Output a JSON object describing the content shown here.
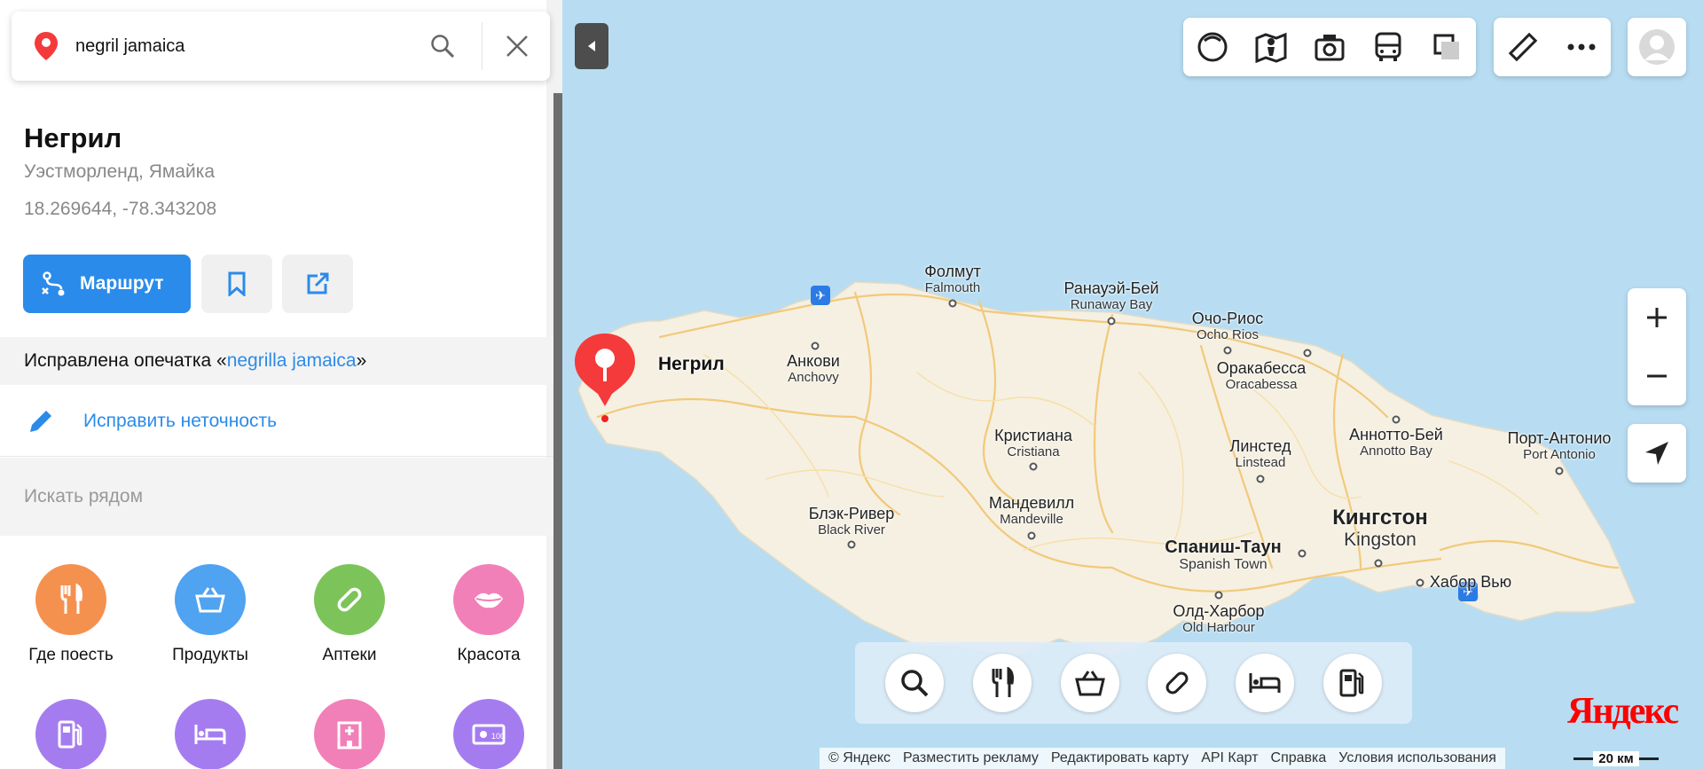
{
  "search": {
    "query": "negril jamaica"
  },
  "place": {
    "title": "Негрил",
    "subtitle": "Уэстморленд, Ямайка",
    "coords": "18.269644, -78.343208"
  },
  "actions": {
    "route_label": "Маршрут"
  },
  "typo": {
    "prefix": "Исправлена опечатка «",
    "link": "negrilla jamaica",
    "suffix": "»"
  },
  "fix_label": "Исправить неточность",
  "nearby_label": "Искать рядом",
  "categories": [
    {
      "label": "Где поесть",
      "color": "#f5914f",
      "icon": "fork-knife-icon"
    },
    {
      "label": "Продукты",
      "color": "#4fa3f0",
      "icon": "basket-icon"
    },
    {
      "label": "Аптеки",
      "color": "#7cc45a",
      "icon": "pill-icon"
    },
    {
      "label": "Красота",
      "color": "#f280b8",
      "icon": "lips-icon"
    },
    {
      "label": "",
      "color": "#a57cf0",
      "icon": "gas-station-icon"
    },
    {
      "label": "",
      "color": "#a57cf0",
      "icon": "bed-icon"
    },
    {
      "label": "",
      "color": "#f280b8",
      "icon": "hospital-icon"
    },
    {
      "label": "",
      "color": "#a57cf0",
      "icon": "money-icon"
    }
  ],
  "map": {
    "negril_label": "Негрил",
    "places": [
      {
        "ru": "Фолмут",
        "en": "Falmouth",
        "cls": "town"
      },
      {
        "ru": "Ранауэй-Бей",
        "en": "Runaway Bay",
        "cls": "town"
      },
      {
        "ru": "Очо-Риос",
        "en": "Ocho Rios",
        "cls": "town"
      },
      {
        "ru": "Анкови",
        "en": "Anchovy",
        "cls": "town"
      },
      {
        "ru": "Оракабесса",
        "en": "Oracabessa",
        "cls": "town"
      },
      {
        "ru": "Кристиана",
        "en": "Cristiana",
        "cls": "town"
      },
      {
        "ru": "Линстед",
        "en": "Linstead",
        "cls": "town"
      },
      {
        "ru": "Аннотто-Бей",
        "en": "Annotto Bay",
        "cls": "town"
      },
      {
        "ru": "Порт-Антонио",
        "en": "Port Antonio",
        "cls": "town"
      },
      {
        "ru": "Блэк-Ривер",
        "en": "Black River",
        "cls": "town"
      },
      {
        "ru": "Мандевилл",
        "en": "Mandeville",
        "cls": "town"
      },
      {
        "ru": "Кингстон",
        "en": "Kingston",
        "cls": "big"
      },
      {
        "ru": "Спаниш-Таун",
        "en": "Spanish Town",
        "cls": "mid"
      },
      {
        "ru": "Хабор Вью",
        "en": "",
        "cls": "town"
      },
      {
        "ru": "Олд-Харбор",
        "en": "Old Harbour",
        "cls": "town"
      }
    ],
    "logo": "Яндекс",
    "scale": "20 км",
    "footer": [
      "© Яндекс",
      "Разместить рекламу",
      "Редактировать карту",
      "API Карт",
      "Справка",
      "Условия использования"
    ]
  }
}
